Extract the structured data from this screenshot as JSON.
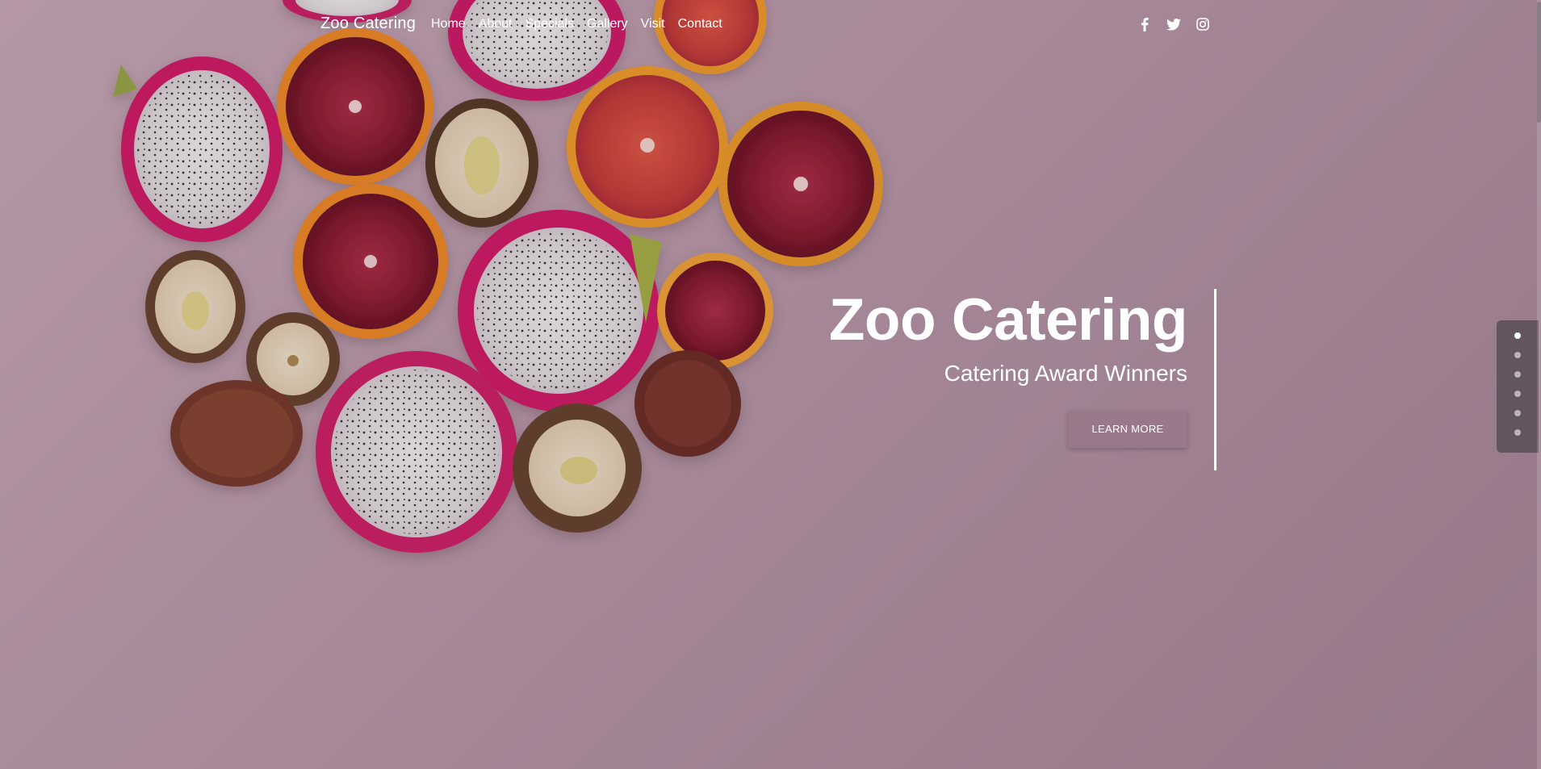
{
  "navbar": {
    "brand": "Zoo Catering",
    "links": [
      "Home",
      "About",
      "Specials",
      "Gallery",
      "Visit",
      "Contact"
    ],
    "social": [
      "facebook-icon",
      "twitter-icon",
      "instagram-icon"
    ]
  },
  "hero": {
    "title": "Zoo Catering",
    "subtitle": "Catering Award Winners",
    "button_label": "LEARN MORE",
    "background_image": "fruit-slices-photo"
  },
  "side_nav": {
    "dot_count": 6,
    "active_index": 0
  },
  "colors": {
    "background": "#bb9aab",
    "text": "#ffffff",
    "button_bg": "#967688",
    "dot_nav_bg": "#5a5056"
  }
}
